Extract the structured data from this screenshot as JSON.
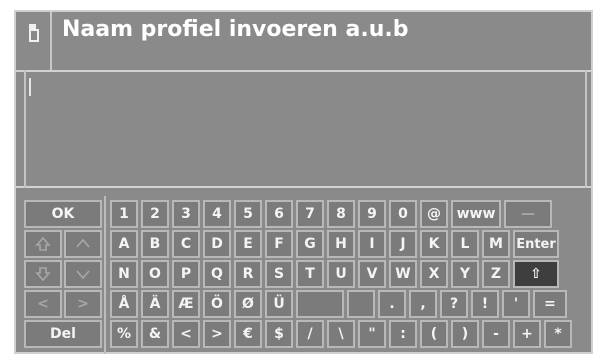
{
  "header": {
    "title": "Naam profiel invoeren a.u.b",
    "icon": "profile-icon"
  },
  "input": {
    "value": ""
  },
  "control_keys": [
    {
      "label": "OK",
      "name": "ok-key",
      "icon": ""
    },
    {
      "label": "",
      "name": "shift-up-disabled-key",
      "icon": "shift-up-icon"
    },
    {
      "label": "",
      "name": "up-disabled-key",
      "icon": "chevron-up-icon"
    },
    {
      "label": "",
      "name": "shift-down-disabled-key",
      "icon": "shift-down-icon"
    },
    {
      "label": "",
      "name": "down-disabled-key",
      "icon": "chevron-down-icon"
    },
    {
      "label": "<",
      "name": "left-key",
      "icon": ""
    },
    {
      "label": ">",
      "name": "right-key",
      "icon": ""
    },
    {
      "label": "Del",
      "name": "delete-key",
      "icon": ""
    }
  ],
  "keyboard_rows": [
    [
      "1",
      "2",
      "3",
      "4",
      "5",
      "6",
      "7",
      "8",
      "9",
      "0",
      "@",
      "www",
      "—"
    ],
    [
      "A",
      "B",
      "C",
      "D",
      "E",
      "F",
      "G",
      "H",
      "I",
      "J",
      "K",
      "L",
      "M",
      "Enter"
    ],
    [
      "N",
      "O",
      "P",
      "Q",
      "R",
      "S",
      "T",
      "U",
      "V",
      "W",
      "X",
      "Y",
      "Z",
      "⇧"
    ],
    [
      "Å",
      "Ä",
      "Æ",
      "Ö",
      "Ø",
      "Ü",
      "",
      "",
      ".",
      ",",
      "?",
      "!",
      "'",
      "="
    ],
    [
      "%",
      "&",
      "<",
      ">",
      "€",
      "$",
      "/",
      "\\",
      "\"",
      ":",
      "(",
      ")",
      "-",
      "+",
      "*"
    ]
  ],
  "colors": {
    "panel": "#8a8a8a",
    "key": "#7b7b7b",
    "active_key": "#3e3e3e",
    "text": "#ffffff"
  }
}
